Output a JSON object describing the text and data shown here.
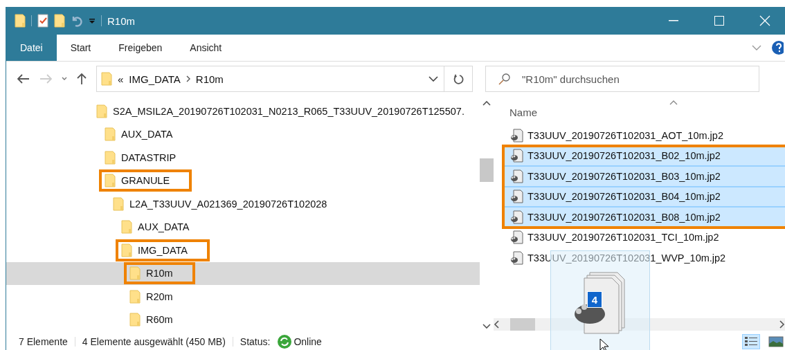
{
  "window": {
    "title": "R10m"
  },
  "ribbon_tabs": [
    {
      "label": "Datei",
      "selected": true
    },
    {
      "label": "Start",
      "selected": false
    },
    {
      "label": "Freigeben",
      "selected": false
    },
    {
      "label": "Ansicht",
      "selected": false
    }
  ],
  "address": {
    "overflow": "«",
    "parts": [
      "IMG_DATA",
      "R10m"
    ]
  },
  "search": {
    "placeholder": "\"R10m\" durchsuchen"
  },
  "tree": [
    {
      "label": "S2A_MSIL2A_20190726T102031_N0213_R065_T33UUV_20190726T125507.",
      "selected": false,
      "highlighted": false,
      "children": [
        {
          "label": "AUX_DATA",
          "selected": false,
          "highlighted": false
        },
        {
          "label": "DATASTRIP",
          "selected": false,
          "highlighted": false
        },
        {
          "label": "GRANULE",
          "selected": false,
          "highlighted": true,
          "children": [
            {
              "label": "L2A_T33UUV_A021369_20190726T102028",
              "selected": false,
              "highlighted": false,
              "children": [
                {
                  "label": "AUX_DATA",
                  "selected": false,
                  "highlighted": false
                },
                {
                  "label": "IMG_DATA",
                  "selected": false,
                  "highlighted": true,
                  "children": [
                    {
                      "label": "R10m",
                      "selected": true,
                      "highlighted": true
                    },
                    {
                      "label": "R20m",
                      "selected": false,
                      "highlighted": false
                    },
                    {
                      "label": "R60m",
                      "selected": false,
                      "highlighted": false
                    }
                  ]
                }
              ]
            }
          ]
        }
      ]
    }
  ],
  "file_list": {
    "column": "Name",
    "files": [
      {
        "name": "T33UUV_20190726T102031_AOT_10m.jp2",
        "selected": false,
        "highlighted": false
      },
      {
        "name": "T33UUV_20190726T102031_B02_10m.jp2",
        "selected": true,
        "highlighted": true
      },
      {
        "name": "T33UUV_20190726T102031_B03_10m.jp2",
        "selected": true,
        "highlighted": true
      },
      {
        "name": "T33UUV_20190726T102031_B04_10m.jp2",
        "selected": true,
        "highlighted": true
      },
      {
        "name": "T33UUV_20190726T102031_B08_10m.jp2",
        "selected": true,
        "highlighted": true
      },
      {
        "name": "T33UUV_20190726T102031_TCI_10m.jp2",
        "selected": false,
        "highlighted": false
      },
      {
        "name": "T33UUV_20190726T102031_WVP_10m.jp2",
        "selected": false,
        "highlighted": false
      }
    ]
  },
  "drag": {
    "count": "4"
  },
  "status_bar": {
    "items": "7 Elemente",
    "selection": "4 Elemente ausgewählt (450 MB)",
    "status_label": "Status:",
    "status": "Online"
  },
  "views": [
    {
      "kind": "details",
      "selected": true
    },
    {
      "kind": "tiles",
      "selected": false
    }
  ]
}
